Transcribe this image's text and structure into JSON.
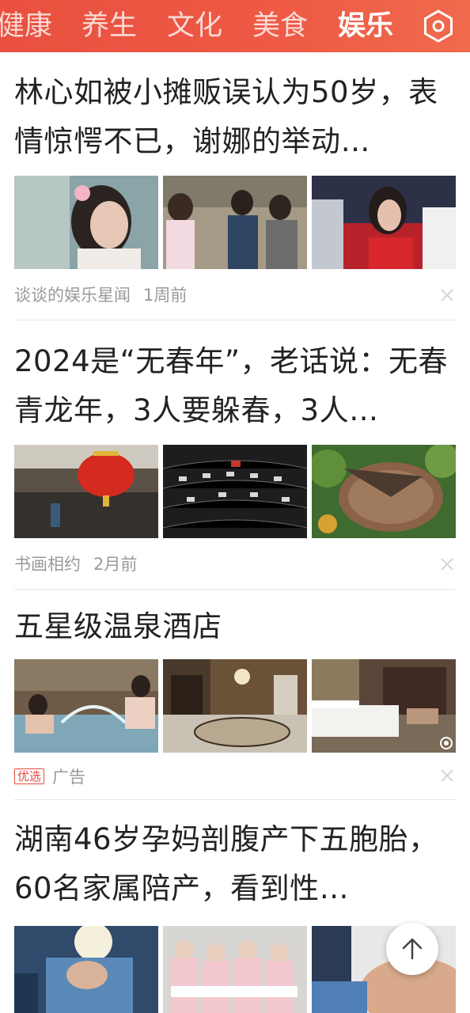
{
  "tabs": [
    {
      "label": "健康"
    },
    {
      "label": "养生"
    },
    {
      "label": "文化"
    },
    {
      "label": "美食"
    },
    {
      "label": "娱乐",
      "active": true
    }
  ],
  "settings_icon": "hexagon-settings-icon",
  "articles": [
    {
      "title": "林心如被小摊贩误认为50岁，表情惊愕不已，谢娜的举动…",
      "source": "谈谈的娱乐星闻",
      "time": "1周前"
    },
    {
      "title": "2024是“无春年”，老话说：无春青龙年，3人要躲春，3人…",
      "source": "书画相约",
      "time": "2月前"
    },
    {
      "title": "五星级温泉酒店",
      "badge": "优选",
      "source": "广告"
    },
    {
      "title": "湖南46岁孕妈剖腹产下五胞胎，60名家属陪产，看到性…"
    }
  ],
  "colors": {
    "header_bg": "#ec5443",
    "badge": "#e34a3e",
    "meta_text": "#999999"
  }
}
